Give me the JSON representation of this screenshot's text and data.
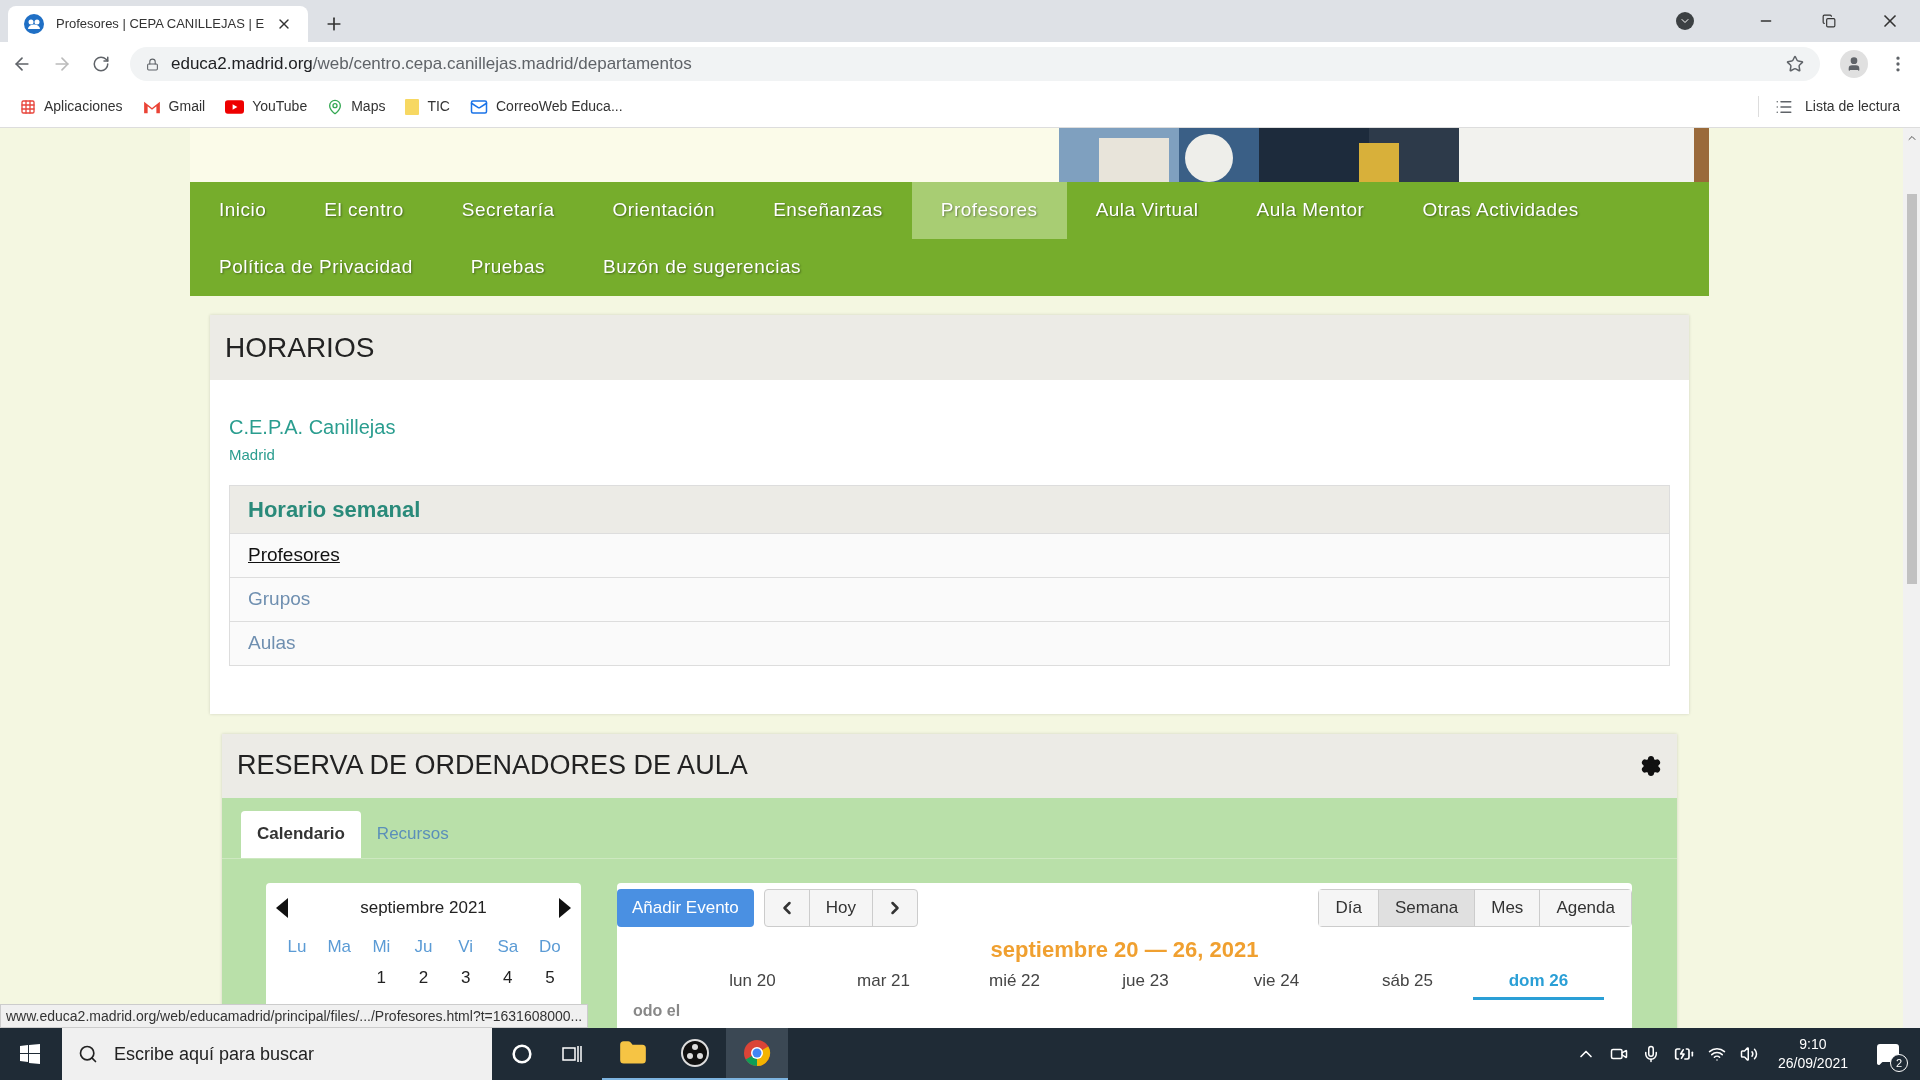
{
  "browser": {
    "tab_title": "Profesores | CEPA CANILLEJAS | E",
    "url_host": "educa2.madrid.org",
    "url_path": "/web/centro.cepa.canillejas.madrid/departamentos",
    "bookmarks": [
      {
        "kind": "apps",
        "label": "Aplicaciones"
      },
      {
        "kind": "gmail",
        "label": "Gmail"
      },
      {
        "kind": "youtube",
        "label": "YouTube"
      },
      {
        "kind": "maps",
        "label": "Maps"
      },
      {
        "kind": "folder",
        "label": "TIC"
      },
      {
        "kind": "mail",
        "label": "CorreoWeb Educa..."
      }
    ],
    "reading_list": "Lista de lectura"
  },
  "nav": [
    {
      "label": "Inicio",
      "selected": false
    },
    {
      "label": "El centro",
      "selected": false
    },
    {
      "label": "Secretaría",
      "selected": false
    },
    {
      "label": "Orientación",
      "selected": false
    },
    {
      "label": "Enseñanzas",
      "selected": false
    },
    {
      "label": "Profesores",
      "selected": true
    },
    {
      "label": "Aula Virtual",
      "selected": false
    },
    {
      "label": "Aula Mentor",
      "selected": false
    },
    {
      "label": "Otras Actividades",
      "selected": false
    },
    {
      "label": "Política de Privacidad",
      "selected": false
    },
    {
      "label": "Pruebas",
      "selected": false
    },
    {
      "label": "Buzón de sugerencias",
      "selected": false
    }
  ],
  "horarios": {
    "title": "HORARIOS",
    "school": "C.E.P.A. Canillejas",
    "city": "Madrid",
    "section": "Horario semanal",
    "items": [
      {
        "label": "Profesores",
        "hovered": true
      },
      {
        "label": "Grupos",
        "hovered": false
      },
      {
        "label": "Aulas",
        "hovered": false
      }
    ]
  },
  "reserva": {
    "title": "RESERVA DE ORDENADORES DE AULA",
    "tabs": [
      {
        "label": "Calendario",
        "selected": true
      },
      {
        "label": "Recursos",
        "selected": false
      }
    ],
    "mini_calendar": {
      "month": "septiembre 2021",
      "weekdays": [
        "Lu",
        "Ma",
        "Mi",
        "Ju",
        "Vi",
        "Sa",
        "Do"
      ],
      "first_week": [
        "1",
        "2",
        "3",
        "4",
        "5"
      ]
    },
    "add_event": "Añadir Evento",
    "today": "Hoy",
    "views": [
      {
        "label": "Día",
        "selected": false
      },
      {
        "label": "Semana",
        "selected": true
      },
      {
        "label": "Mes",
        "selected": false
      },
      {
        "label": "Agenda",
        "selected": false
      }
    ],
    "range": "septiembre 20 — 26, 2021",
    "days": [
      {
        "label": "lun 20",
        "selected": false
      },
      {
        "label": "mar 21",
        "selected": false
      },
      {
        "label": "mié 22",
        "selected": false
      },
      {
        "label": "jue 23",
        "selected": false
      },
      {
        "label": "vie 24",
        "selected": false
      },
      {
        "label": "sáb 25",
        "selected": false
      },
      {
        "label": "dom 26",
        "selected": true
      }
    ],
    "all_day": "odo el"
  },
  "status_url": "www.educa2.madrid.org/web/educamadrid/principal/files/.../Profesores.html?t=1631608000...",
  "taskbar": {
    "search_placeholder": "Escribe aquí para buscar",
    "time": "9:10",
    "date": "26/09/2021",
    "notifications": "2"
  }
}
